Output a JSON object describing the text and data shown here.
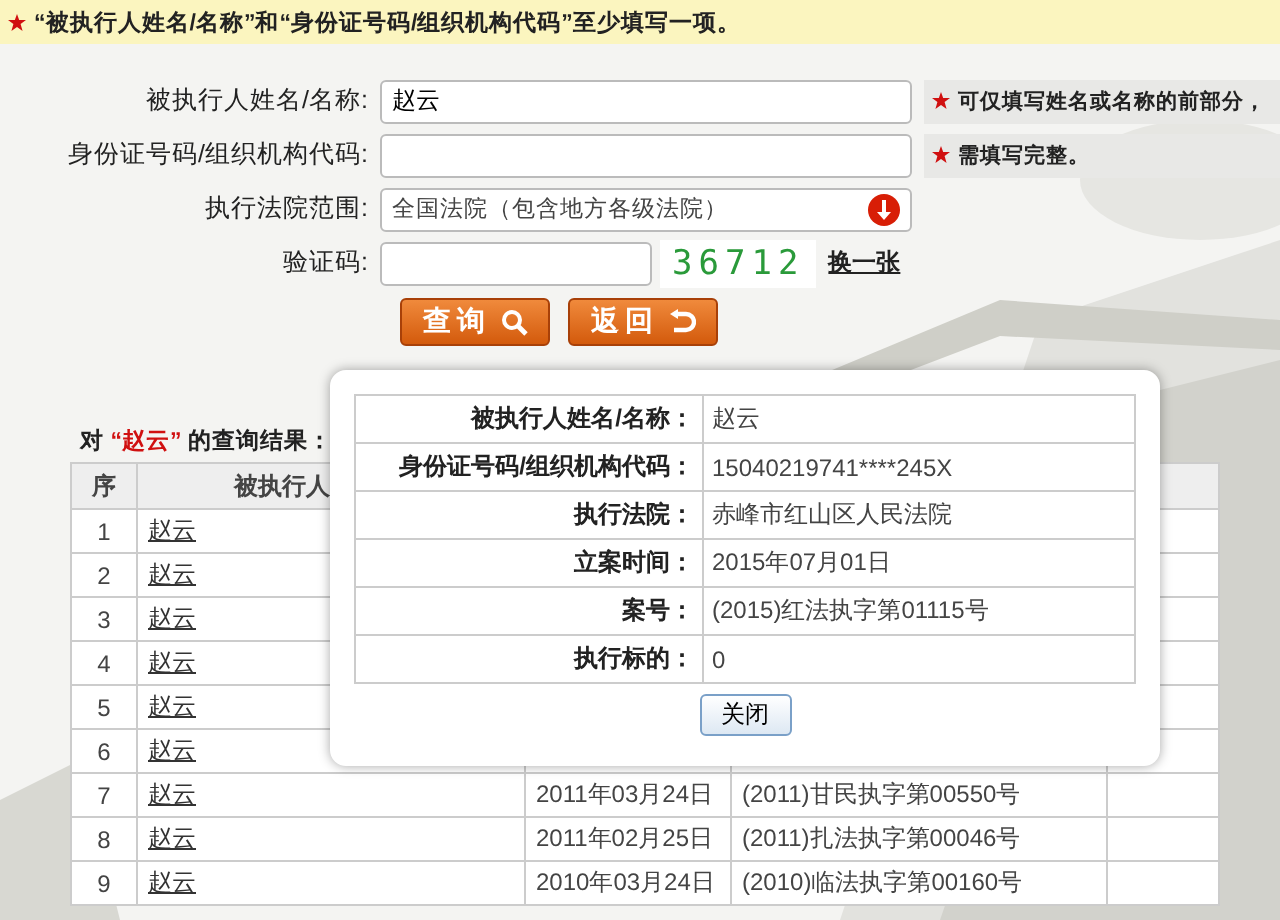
{
  "notice": "“被执行人姓名/名称”和“身份证号码/组织机构代码”至少填写一项。",
  "form": {
    "fields": [
      {
        "kind": "text",
        "label": "被执行人姓名/名称:",
        "value": "赵云",
        "hint": "可仅填写姓名或名称的前部分，"
      },
      {
        "kind": "text",
        "label": "身份证号码/组织机构代码:",
        "hint": "需填写完整。"
      },
      {
        "kind": "select",
        "label": "执行法院范围:",
        "value": "全国法院（包含地方各级法院）"
      },
      {
        "kind": "captcha",
        "label": "验证码:",
        "captcha": "36712",
        "refresh": "换一张"
      }
    ],
    "buttons": [
      {
        "kind": "search",
        "label": "查询"
      },
      {
        "kind": "back",
        "label": "返回"
      }
    ]
  },
  "results": {
    "prefix": "对",
    "keyword": "“赵云”",
    "suffix": "的查询结果：",
    "columns": [
      "序",
      "被执行人"
    ],
    "rows": [
      {
        "index": "1",
        "name": "赵云"
      },
      {
        "index": "2",
        "name": "赵云"
      },
      {
        "index": "3",
        "name": "赵云"
      },
      {
        "index": "4",
        "name": "赵云"
      },
      {
        "index": "5",
        "name": "赵云"
      },
      {
        "index": "6",
        "name": "赵云"
      },
      {
        "index": "7",
        "name": "赵云",
        "date": "2011年03月24日",
        "case": "(2011)甘民执字第00550号"
      },
      {
        "index": "8",
        "name": "赵云",
        "date": "2011年02月25日",
        "case": "(2011)扎法执字第00046号"
      },
      {
        "index": "9",
        "name": "赵云",
        "date": "2010年03月24日",
        "case": "(2010)临法执字第00160号"
      }
    ]
  },
  "dialog": {
    "rows": [
      {
        "label": "被执行人姓名/名称：",
        "value": "赵云"
      },
      {
        "label": "身份证号码/组织机构代码：",
        "value": "15040219741****245X"
      },
      {
        "label": "执行法院：",
        "value": "赤峰市红山区人民法院"
      },
      {
        "label": "立案时间：",
        "value": "2015年07月01日"
      },
      {
        "label": "案号：",
        "value": "(2015)红法执字第01115号"
      },
      {
        "label": "执行标的：",
        "value": "0"
      }
    ],
    "close": "关闭"
  }
}
